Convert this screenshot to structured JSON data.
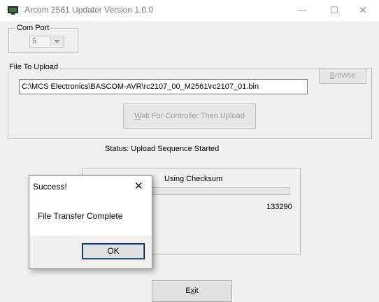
{
  "window": {
    "title": "Arcom 2561 Updater Version 1.0.0",
    "minimize_glyph": "—",
    "maximize_glyph": "☐",
    "close_glyph": "✕",
    "icon": "monitor-icon"
  },
  "com_port": {
    "legend": "Com Port",
    "value": "5"
  },
  "file_upload": {
    "legend": "File To Upload",
    "path": "C:\\MCS Electronics\\BASCOM-AVR\\rc2107_00_M2561\\rc2107_01.bin",
    "browse_prefix": "B",
    "browse_rest": "rowse",
    "wait_prefix": "W",
    "wait_rest": "ait For Controller Then Upload"
  },
  "status": {
    "text": "Status: Upload Sequence Started"
  },
  "progress_panel": {
    "checksum_label": "Using Checksum",
    "count": "133290",
    "progress_fraction": 0
  },
  "exit_button": {
    "prefix": "E",
    "mnemonic": "x",
    "rest": "it"
  },
  "dialog": {
    "title": "Success!",
    "close_glyph": "✕",
    "message": "File Transfer Complete",
    "ok_label": "OK"
  },
  "colors": {
    "accent": "#0078d7",
    "window_bg": "#f0f0f0"
  }
}
